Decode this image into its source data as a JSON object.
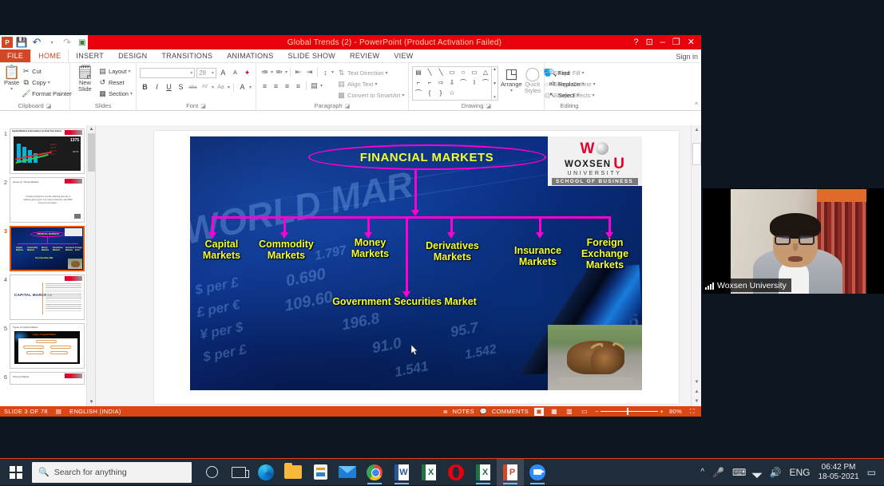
{
  "window": {
    "title": "Global Trends (2)  -  PowerPoint (Product Activation Failed)",
    "signin": "Sign in",
    "help_icon": "?",
    "ribbon_display_icon": "⊡",
    "minimize_icon": "–",
    "restore_icon": "❐",
    "close_icon": "✕"
  },
  "quick_access": {
    "app_icon": "P",
    "save_icon": "💾",
    "undo_icon": "↶",
    "redo_icon": "↷",
    "start_slideshow_icon": "▣",
    "customize_icon": "▾"
  },
  "tabs": [
    {
      "label": "FILE",
      "active": false
    },
    {
      "label": "HOME",
      "active": true
    },
    {
      "label": "INSERT",
      "active": false
    },
    {
      "label": "DESIGN",
      "active": false
    },
    {
      "label": "TRANSITIONS",
      "active": false
    },
    {
      "label": "ANIMATIONS",
      "active": false
    },
    {
      "label": "SLIDE SHOW",
      "active": false
    },
    {
      "label": "REVIEW",
      "active": false
    },
    {
      "label": "VIEW",
      "active": false
    }
  ],
  "ribbon": {
    "clipboard": {
      "group_label": "Clipboard",
      "paste_label": "Paste",
      "paste_icon": "clipboard-icon",
      "cut_label": "Cut",
      "copy_label": "Copy",
      "format_painter_label": "Format Painter"
    },
    "slides": {
      "group_label": "Slides",
      "new_slide_label": "New Slide",
      "layout_label": "Layout",
      "reset_label": "Reset",
      "section_label": "Section"
    },
    "font": {
      "group_label": "Font",
      "font_name_value": "",
      "font_size_value": "28",
      "grow_font_icon": "A",
      "shrink_font_icon": "A",
      "clear_formatting_icon": "✦",
      "bold_icon": "B",
      "italic_icon": "I",
      "underline_icon": "U",
      "shadow_icon": "S",
      "strikethrough_icon": "abc",
      "character_spacing_icon": "AV",
      "change_case_icon": "Aa",
      "font_color_icon": "A"
    },
    "paragraph": {
      "group_label": "Paragraph",
      "bullets_icon": "≔",
      "numbering_icon": "≕",
      "decrease_indent_icon": "⇤",
      "increase_indent_icon": "⇥",
      "line_spacing_icon": "↕",
      "text_direction_label": "Text Direction",
      "align_text_label": "Align Text",
      "convert_smartart_label": "Convert to SmartArt",
      "align_left_icon": "≡",
      "align_center_icon": "≡",
      "align_right_icon": "≡",
      "justify_icon": "≡",
      "columns_icon": "▤"
    },
    "drawing": {
      "group_label": "Drawing",
      "arrange_label": "Arrange",
      "quick_styles_label": "Quick Styles",
      "shape_fill_label": "Shape Fill",
      "shape_outline_label": "Shape Outline",
      "shape_effects_label": "Shape Effects",
      "shapes": [
        "▤",
        "╲",
        "╲",
        "▭",
        "○",
        "▭",
        "△",
        "⌐",
        "⌐",
        "⇨",
        "⇩",
        "⌒",
        "⌇",
        "⌒",
        "⌒",
        "{",
        "}",
        "☆"
      ]
    },
    "editing": {
      "group_label": "Editing",
      "find_label": "Find",
      "replace_label": "Replace",
      "select_label": "Select"
    },
    "collapse_ribbon_icon": "^"
  },
  "thumbnails": [
    {
      "number": "1",
      "title": "Capital Markets & Derivatives by Final Year Interns",
      "selected": false
    },
    {
      "number": "2",
      "title": "Quote on \"Stock Market\"",
      "selected": false
    },
    {
      "number": "3",
      "title": "Financial Markets",
      "selected": true
    },
    {
      "number": "4",
      "title": "CAPITAL MARKETS",
      "selected": false
    },
    {
      "number": "5",
      "title": "Types of Capital Market",
      "selected": false
    },
    {
      "number": "6",
      "title": "Primary Market",
      "selected": false
    }
  ],
  "slide": {
    "title": "FINANCIAL MARKETS",
    "nodes": [
      {
        "label": "Capital\nMarkets"
      },
      {
        "label": "Commodity\nMarkets"
      },
      {
        "label": "Money\nMarkets"
      },
      {
        "label": "Derivatives\nMarkets"
      },
      {
        "label": "Insurance\nMarkets"
      },
      {
        "label": "Foreign\nExchange\nMarkets"
      }
    ],
    "center_node": "Government Securities Market",
    "logo": {
      "w_letter": "W",
      "u_letter": "U",
      "name": "WOXSEN",
      "university": "UNIVERSITY",
      "school": "SCHOOL OF BUSINESS"
    }
  },
  "status_bar": {
    "slide_indicator": "SLIDE 3 OF 78",
    "language_icon": "spell-check-icon",
    "language": "ENGLISH (INDIA)",
    "notes_label": "NOTES",
    "comments_label": "COMMENTS",
    "view_normal_icon": "▣",
    "view_sorter_icon": "▦",
    "view_reading_icon": "▥",
    "view_slideshow_icon": "▭",
    "zoom_out_icon": "−",
    "zoom_in_icon": "+",
    "zoom_level": "80%",
    "fit_slide_icon": "⛶"
  },
  "video": {
    "participant_name": "Woxsen University",
    "signal_icon": "signal-bars-icon"
  },
  "taskbar": {
    "start_icon": "windows-logo-icon",
    "search_placeholder": "Search for anything",
    "search_icon": "search-icon",
    "cortana_icon": "cortana-icon",
    "task_view_icon": "task-view-icon",
    "apps": [
      {
        "name": "edge-icon",
        "label": "E",
        "running": false
      },
      {
        "name": "file-explorer-icon",
        "label": "",
        "running": false
      },
      {
        "name": "microsoft-store-icon",
        "label": "",
        "running": false
      },
      {
        "name": "mail-icon",
        "label": "",
        "running": false
      },
      {
        "name": "chrome-icon",
        "label": "",
        "running": true
      },
      {
        "name": "word-icon",
        "label": "W",
        "running": true
      },
      {
        "name": "excel-icon",
        "label": "X",
        "running": false
      },
      {
        "name": "opera-icon",
        "label": "O",
        "running": false
      },
      {
        "name": "excel-2-icon",
        "label": "X",
        "running": true
      },
      {
        "name": "powerpoint-icon",
        "label": "P",
        "running": true
      },
      {
        "name": "zoom-icon",
        "label": "",
        "running": true
      }
    ],
    "tray": {
      "show_hidden_icon": "^",
      "mic_icon": "🎤",
      "keyboard_icon": "⌨",
      "wifi_icon": "◤",
      "volume_icon": "🔊",
      "language": "ENG",
      "time": "06:42 PM",
      "date": "18-05-2021",
      "action_center_icon": "▭"
    }
  }
}
